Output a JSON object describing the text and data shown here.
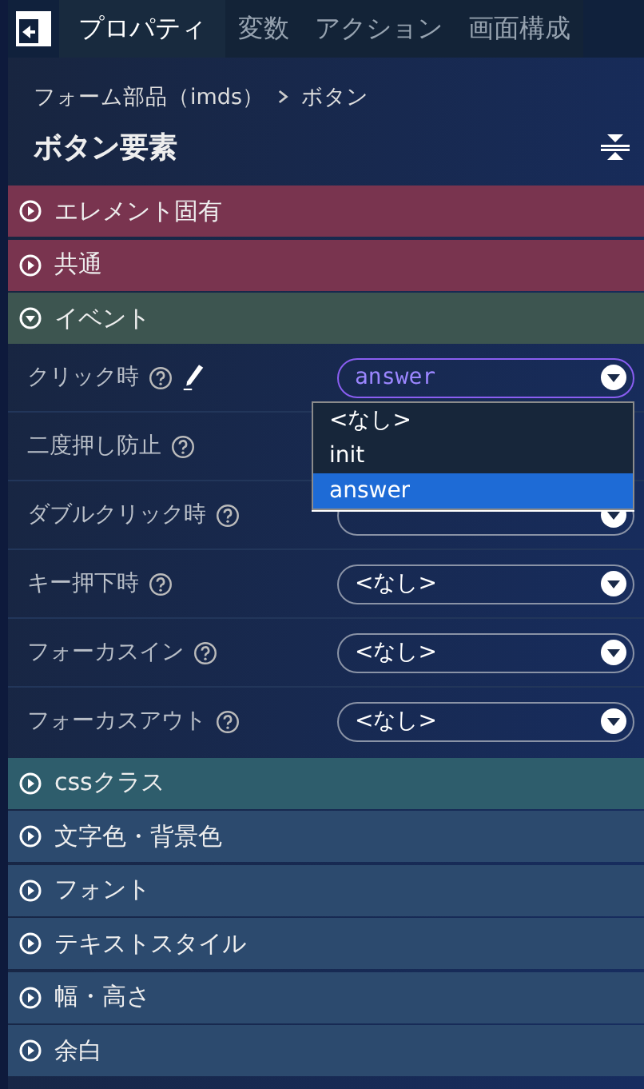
{
  "tabs": [
    {
      "label": "プロパティ",
      "selected": true
    },
    {
      "label": "変数",
      "selected": false
    },
    {
      "label": "アクション",
      "selected": false
    },
    {
      "label": "画面構成",
      "selected": false
    }
  ],
  "breadcrumb": [
    "フォーム部品（imds）",
    "ボタン"
  ],
  "title": "ボタン要素",
  "sections": [
    {
      "label": "エレメント固有",
      "expanded": false,
      "color": "#79344f"
    },
    {
      "label": "共通",
      "expanded": false,
      "color": "#79344f"
    },
    {
      "label": "イベント",
      "expanded": true,
      "color": "#3d5550",
      "fields": [
        {
          "label": "クリック時",
          "kind": "select",
          "value": "answer",
          "active": true,
          "editable": true,
          "dropdown": [
            {
              "label": "<なし>",
              "selected": false
            },
            {
              "label": "init",
              "selected": false
            },
            {
              "label": "answer",
              "selected": true
            }
          ]
        },
        {
          "label": "二度押し防止",
          "kind": "hidden"
        },
        {
          "label": "ダブルクリック時",
          "kind": "select",
          "active": false
        },
        {
          "label": "キー押下時",
          "kind": "select",
          "value": "<なし>",
          "active": false
        },
        {
          "label": "フォーカスイン",
          "kind": "select",
          "value": "<なし>",
          "active": false
        },
        {
          "label": "フォーカスアウト",
          "kind": "select",
          "value": "<なし>",
          "active": false
        }
      ]
    },
    {
      "label": "cssクラス",
      "expanded": false,
      "color": "#2e5d6c"
    },
    {
      "label": "文字色・背景色",
      "expanded": false,
      "color": "#2c4a6e"
    },
    {
      "label": "フォント",
      "expanded": false,
      "color": "#2c4a6e"
    },
    {
      "label": "テキストスタイル",
      "expanded": false,
      "color": "#2c4a6e"
    },
    {
      "label": "幅・高さ",
      "expanded": false,
      "color": "#2c4a6e"
    },
    {
      "label": "余白",
      "expanded": false,
      "color": "#2c4a6e"
    }
  ]
}
